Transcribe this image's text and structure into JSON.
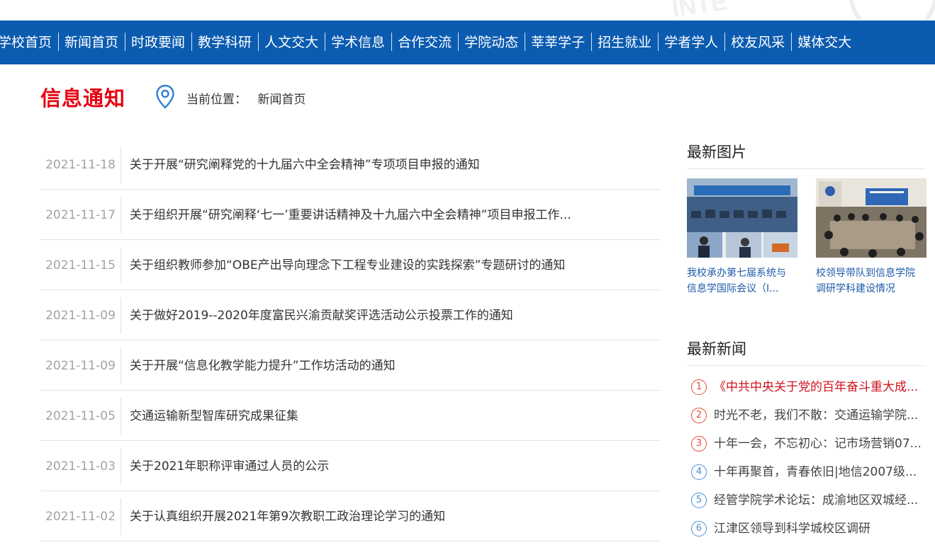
{
  "nav": [
    "学校首页",
    "新闻首页",
    "时政要闻",
    "教学科研",
    "人文交大",
    "学术信息",
    "合作交流",
    "学院动态",
    "莘莘学子",
    "招生就业",
    "学者学人",
    "校友风采",
    "媒体交大"
  ],
  "section_title": "信息通知",
  "breadcrumb": {
    "label": "当前位置：",
    "current": "新闻首页"
  },
  "notices": [
    {
      "date": "2021-11-18",
      "title": "关于开展“研究阐释党的十九届六中全会精神”专项项目申报的通知"
    },
    {
      "date": "2021-11-17",
      "title": "关于组织开展“研究阐释‘七一’重要讲话精神及十九届六中全会精神”项目申报工作..."
    },
    {
      "date": "2021-11-15",
      "title": "关于组织教师参加“OBE产出导向理念下工程专业建设的实践探索”专题研讨的通知"
    },
    {
      "date": "2021-11-09",
      "title": "关于做好2019--2020年度富民兴渝贡献奖评选活动公示投票工作的通知"
    },
    {
      "date": "2021-11-09",
      "title": "关于开展“信息化教学能力提升”工作坊活动的通知"
    },
    {
      "date": "2021-11-05",
      "title": "交通运输新型智库研究成果征集"
    },
    {
      "date": "2021-11-03",
      "title": "关于2021年职称评审通过人员的公示"
    },
    {
      "date": "2021-11-02",
      "title": "关于认真组织开展2021年第9次教职工政治理论学习的通知"
    }
  ],
  "latest_pics": {
    "heading": "最新图片",
    "items": [
      {
        "caption_1": "我校承办第七届系统与",
        "caption_2": "信息学国际会议（I..."
      },
      {
        "caption_1": "校领导带队到信息学院",
        "caption_2": "调研学科建设情况"
      }
    ]
  },
  "latest_news": {
    "heading": "最新新闻",
    "items": [
      {
        "num": "1",
        "title": "《中共中央关于党的百年奋斗重大成..."
      },
      {
        "num": "2",
        "title": "时光不老，我们不散：交通运输学院..."
      },
      {
        "num": "3",
        "title": "十年一会，不忘初心：记市场营销07..."
      },
      {
        "num": "4",
        "title": "十年再聚首，青春依旧|地信2007级..."
      },
      {
        "num": "5",
        "title": "经管学院学术论坛：成渝地区双城经..."
      },
      {
        "num": "6",
        "title": "江津区领导到科学城校区调研"
      }
    ]
  },
  "colors": {
    "nav_bg": "#0b5bb0",
    "title_red": "#e60012",
    "link_blue": "#1e5aa8"
  }
}
